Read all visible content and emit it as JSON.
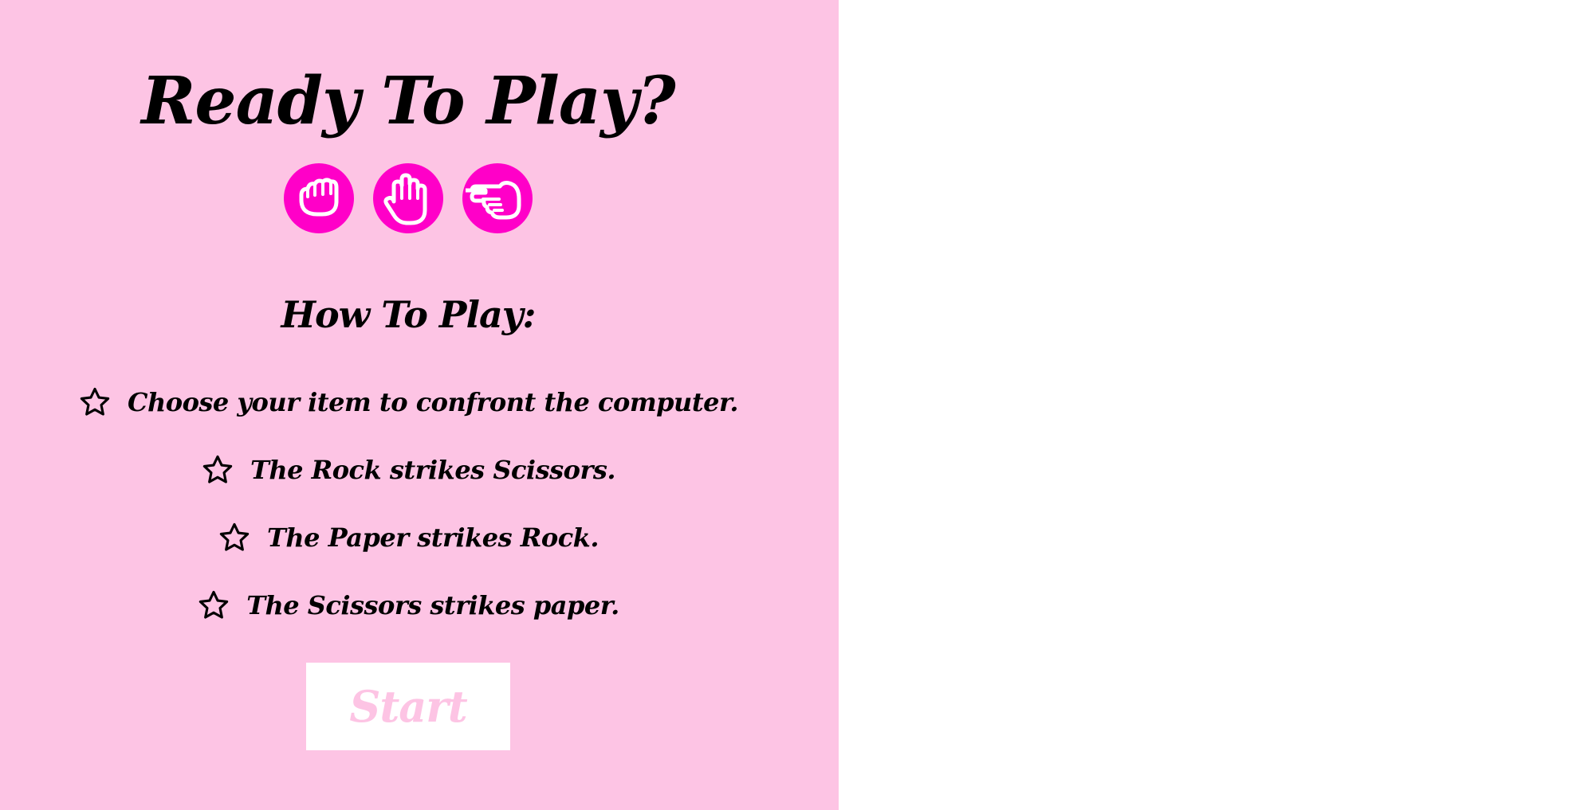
{
  "colors": {
    "panel_background": "#fdc4e4",
    "accent": "#ff00c8",
    "text": "#000000",
    "button_background": "#ffffff",
    "button_text": "#fdc4e4"
  },
  "intro": {
    "title": "Ready To Play?",
    "choices": [
      {
        "icon": "rock-hand-icon"
      },
      {
        "icon": "paper-hand-icon"
      },
      {
        "icon": "scissors-hand-icon"
      }
    ]
  },
  "how_to_play": {
    "heading": "How To Play:",
    "bullet_icon": "star-outline-icon",
    "rules": [
      "Choose your item to confront the computer.",
      "The Rock strikes Scissors.",
      "The Paper strikes Rock.",
      "The Scissors strikes paper."
    ]
  },
  "start_button": {
    "label": "Start"
  }
}
